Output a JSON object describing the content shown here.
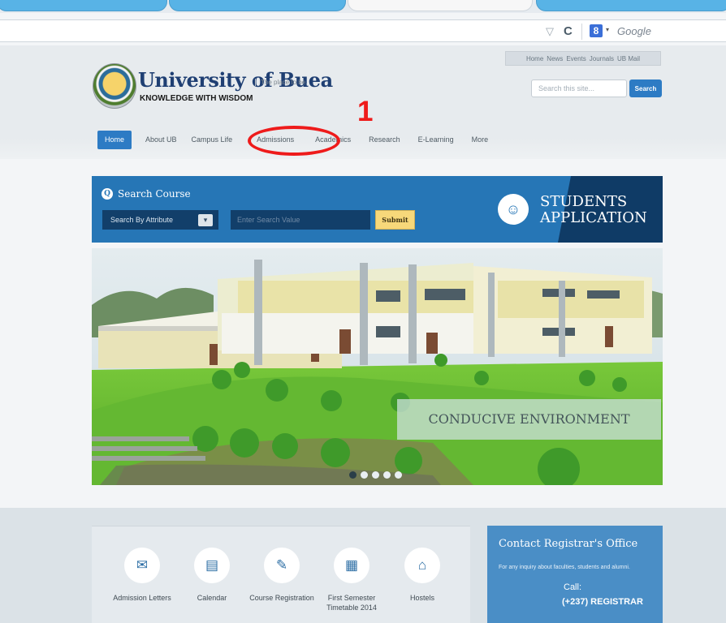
{
  "browser": {
    "rss_glyph": "▽",
    "reload_glyph": "C",
    "search_engine_logo": "8",
    "dropdown_glyph": "▾",
    "search_engine": "Google"
  },
  "site": {
    "name": "University of Buea",
    "tagline": "The place to be.",
    "motto": "KNOWLEDGE WITH WISDOM",
    "seal_text": "UNIVERSITY OF BUEA",
    "top_links": [
      "Home",
      "News",
      "Events",
      "Journals",
      "UB Mail"
    ],
    "search_placeholder": "Search this site...",
    "search_button": "Search"
  },
  "nav": [
    "Home",
    "About UB",
    "Campus Life",
    "Admissions",
    "Academics",
    "Research",
    "E-Learning",
    "More"
  ],
  "annotation": {
    "number": "1",
    "color": "#ee1b1b"
  },
  "course_search": {
    "title": "Search Course",
    "attribute_select": "Search By Attribute",
    "value_placeholder": "Enter Search Value",
    "submit": "Submit"
  },
  "application": {
    "line1": "STUDENTS",
    "line2": "APPLICATION"
  },
  "hero": {
    "caption": "CONDUCIVE ENVIRONMENT",
    "slide_count": 5,
    "active_slide": 1
  },
  "quick_links": [
    {
      "label": "Admission Letters",
      "icon": "envelope-icon"
    },
    {
      "label": "Calendar",
      "icon": "calendar-icon"
    },
    {
      "label": "Course Registration",
      "icon": "book-icon"
    },
    {
      "label": "First Semester Timetable 2014",
      "icon": "timetable-icon"
    },
    {
      "label": "Hostels",
      "icon": "home-icon"
    }
  ],
  "contact": {
    "title": "Contact Registrar's Office",
    "text": "For any inquiry about faculties, students and alumni.",
    "call_label": "Call:",
    "phone": "(+237) REGISTRAR"
  },
  "colors": {
    "brand_blue": "#2676b6",
    "dark_blue": "#0f3b66",
    "accent_yellow": "#f7d87a"
  }
}
